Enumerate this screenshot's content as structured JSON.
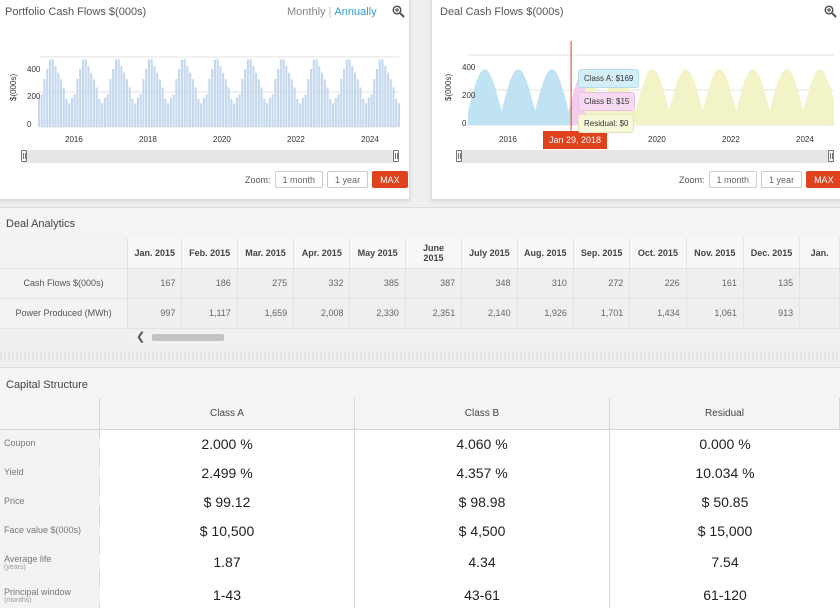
{
  "portfolio_chart": {
    "title": "Portfolio Cash Flows $(000s)",
    "toggle": {
      "monthly": "Monthly",
      "separator": "|",
      "annually": "Annually"
    },
    "zoom_icon": "zoom-in-icon",
    "ylabel": "$(000s)",
    "y_ticks": [
      "400",
      "200",
      "0"
    ],
    "x_ticks": [
      "2016",
      "2018",
      "2020",
      "2022",
      "2024"
    ],
    "zoom": {
      "label": "Zoom:",
      "one_month": "1 month",
      "one_year": "1 year",
      "max": "MAX"
    }
  },
  "deal_chart": {
    "title": "Deal Cash Flows $(000s)",
    "zoom_icon": "zoom-in-icon",
    "ylabel": "$(000s)",
    "y_ticks": [
      "400",
      "200",
      "0"
    ],
    "x_ticks": [
      "2016",
      "2020",
      "2022",
      "2024"
    ],
    "crosshair_date": "Jan 29, 2018",
    "tooltip": {
      "class_a": "Class A: $169",
      "class_b": "Class B: $15",
      "residual": "Residual: $0"
    },
    "zoom": {
      "label": "Zoom:",
      "one_month": "1 month",
      "one_year": "1 year",
      "max": "MAX"
    }
  },
  "chart_data": [
    {
      "type": "area",
      "title": "Portfolio Cash Flows $(000s)",
      "ylabel": "$(000s)",
      "ylim": [
        0,
        480
      ],
      "x_start": "2015-01",
      "x_end": "2025-12",
      "x_ticks": [
        "2016",
        "2018",
        "2020",
        "2022",
        "2024"
      ],
      "series": [
        {
          "name": "Cash Flows",
          "color": "#c5d8ee",
          "annual_pattern": [
            167,
            186,
            275,
            332,
            385,
            387,
            348,
            310,
            272,
            226,
            161,
            135
          ]
        }
      ],
      "grid": true
    },
    {
      "type": "area",
      "title": "Deal Cash Flows $(000s)",
      "ylabel": "$(000s)",
      "ylim": [
        0,
        480
      ],
      "x_start": "2015-01",
      "x_end": "2025-12",
      "x_ticks": [
        "2016",
        "2020",
        "2022",
        "2024"
      ],
      "series": [
        {
          "name": "Class A",
          "color": "#bfe3f2",
          "period": "2015-01 to 2018-01"
        },
        {
          "name": "Class B",
          "color": "#f2cdee",
          "period": "2018-02 to 2018-06"
        },
        {
          "name": "Residual",
          "color": "#f3f3c8",
          "period": "2018-07 to 2025-12"
        }
      ],
      "crosshair": {
        "date": "Jan 29, 2018",
        "class_a": 169,
        "class_b": 15,
        "residual": 0
      },
      "grid": true
    }
  ],
  "deal_analytics": {
    "title": "Deal Analytics",
    "columns": [
      "Jan. 2015",
      "Feb. 2015",
      "Mar. 2015",
      "Apr. 2015",
      "May 2015",
      "June 2015",
      "July 2015",
      "Aug. 2015",
      "Sep. 2015",
      "Oct. 2015",
      "Nov. 2015",
      "Dec. 2015",
      "Jan."
    ],
    "rows": [
      {
        "label": "Cash Flows $(000s)",
        "values": [
          "167",
          "186",
          "275",
          "332",
          "385",
          "387",
          "348",
          "310",
          "272",
          "226",
          "161",
          "135",
          ""
        ]
      },
      {
        "label": "Power Produced (MWh)",
        "values": [
          "997",
          "1,117",
          "1,659",
          "2,008",
          "2,330",
          "2,351",
          "2,140",
          "1,926",
          "1,701",
          "1,434",
          "1,061",
          "913",
          ""
        ]
      }
    ],
    "scroll_left_icon": "chevron-left-icon"
  },
  "capital_structure": {
    "title": "Capital Structure",
    "columns": [
      "Class A",
      "Class B",
      "Residual"
    ],
    "rows": [
      {
        "label": "Coupon",
        "sub": "",
        "values": [
          "2.000 %",
          "4.060 %",
          "0.000 %"
        ]
      },
      {
        "label": "Yield",
        "sub": "",
        "values": [
          "2.499 %",
          "4.357 %",
          "10.034 %"
        ]
      },
      {
        "label": "Price",
        "sub": "",
        "values": [
          "$ 99.12",
          "$ 98.98",
          "$ 50.85"
        ]
      },
      {
        "label": "Face value $(000s)",
        "sub": "",
        "values": [
          "$ 10,500",
          "$ 4,500",
          "$ 15,000"
        ]
      },
      {
        "label": "Average life",
        "sub": "(years)",
        "values": [
          "1.87",
          "4.34",
          "7.54"
        ]
      },
      {
        "label": "Principal window",
        "sub": "(months)",
        "values": [
          "1-43",
          "43-61",
          "61-120"
        ]
      }
    ]
  }
}
